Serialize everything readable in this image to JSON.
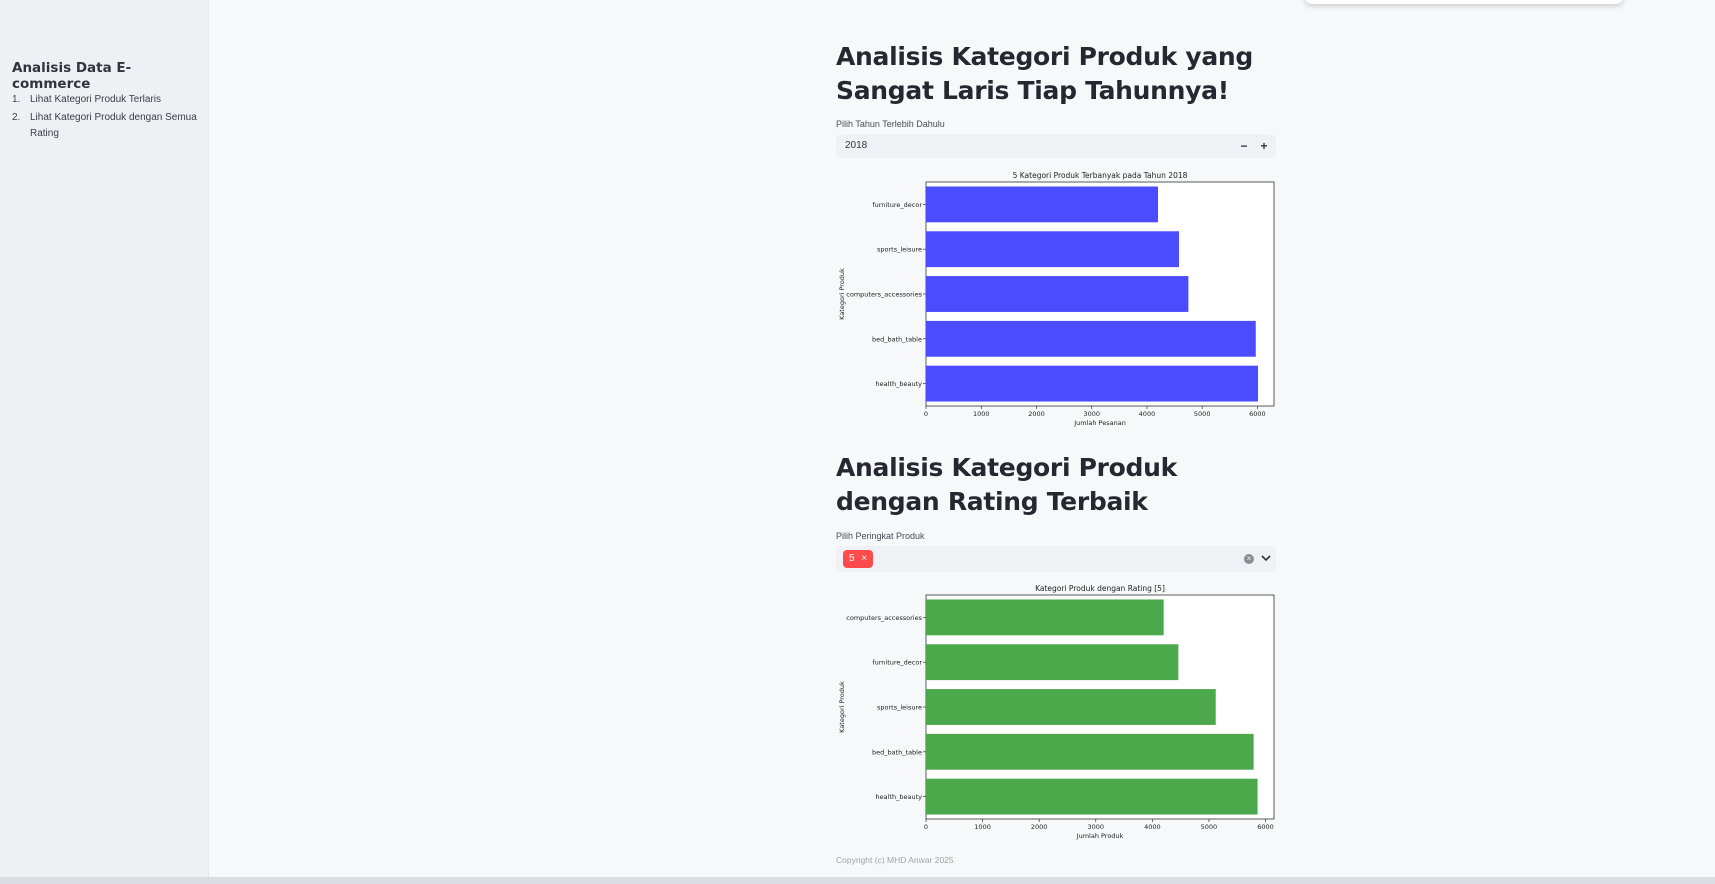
{
  "sidebar": {
    "title": "Analisis Data E-commerce",
    "items": [
      {
        "num": "1.",
        "label": "Lihat Kategori Produk Terlaris"
      },
      {
        "num": "2.",
        "label": "Lihat Kategori Produk dengan Semua Rating"
      }
    ]
  },
  "section1": {
    "heading": "Analisis Kategori Produk yang Sangat Laris Tiap Tahunnya!",
    "input_label": "Pilih Tahun Terlebih Dahulu",
    "year_value": "2018",
    "minus_label": "−",
    "plus_label": "+"
  },
  "section2": {
    "heading": "Analisis Kategori Produk dengan Rating Terbaik",
    "input_label": "Pilih Peringkat Produk",
    "selected_tag": "5",
    "tag_remove": "×"
  },
  "footer": {
    "copyright": "Copyright (c) MHD Anwar 2025"
  },
  "colors": {
    "accent": "#ff4b4b",
    "bar_blue": "#4b4bff",
    "bar_green": "#4ba84b"
  },
  "icons": {
    "clear": "x-circle-icon",
    "dropdown": "chevron-down-icon"
  },
  "chart_data": [
    {
      "type": "bar",
      "orientation": "horizontal",
      "title": "5 Kategori Produk Terbanyak pada Tahun 2018",
      "xlabel": "Jumlah Pesanan",
      "ylabel": "Kategori Produk",
      "categories": [
        "furniture_decor",
        "sports_leisure",
        "computers_accessories",
        "bed_bath_table",
        "health_beauty"
      ],
      "values": [
        4200,
        4580,
        4750,
        5970,
        6010
      ],
      "xlim": [
        0,
        6300
      ],
      "xticks": [
        0,
        1000,
        2000,
        3000,
        4000,
        5000,
        6000
      ],
      "color": "#4b4bff"
    },
    {
      "type": "bar",
      "orientation": "horizontal",
      "title": "Kategori Produk dengan Rating [5]",
      "xlabel": "Jumlah Produk",
      "ylabel": "Kategori Produk",
      "categories": [
        "computers_accessories",
        "furniture_decor",
        "sports_leisure",
        "bed_bath_table",
        "health_beauty"
      ],
      "values": [
        4200,
        4460,
        5120,
        5790,
        5860
      ],
      "xlim": [
        0,
        6150
      ],
      "xticks": [
        0,
        1000,
        2000,
        3000,
        4000,
        5000,
        6000
      ],
      "color": "#4ba84b"
    }
  ]
}
